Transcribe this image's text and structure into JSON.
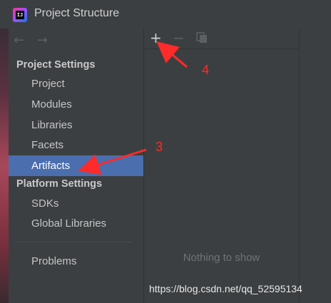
{
  "window": {
    "title": "Project Structure",
    "app_icon_text": "IJ"
  },
  "nav": {
    "back_glyph": "←",
    "forward_glyph": "→"
  },
  "sidebar": {
    "project_settings_header": "Project Settings",
    "platform_settings_header": "Platform Settings",
    "items": [
      {
        "label": "Project"
      },
      {
        "label": "Modules"
      },
      {
        "label": "Libraries"
      },
      {
        "label": "Facets"
      },
      {
        "label": "Artifacts",
        "selected": true
      },
      {
        "label": "SDKs"
      },
      {
        "label": "Global Libraries"
      },
      {
        "label": "Problems"
      }
    ]
  },
  "toolbar": {
    "add_glyph": "+",
    "remove_glyph": "−"
  },
  "panel": {
    "empty_text": "Nothing to show"
  },
  "annotations": {
    "label_3": "3",
    "label_4": "4",
    "color": "#ff2a2a"
  },
  "watermark": "https://blog.csdn.net/qq_52595134",
  "colors": {
    "background": "#3c3f41",
    "selection": "#4b6eaf"
  }
}
